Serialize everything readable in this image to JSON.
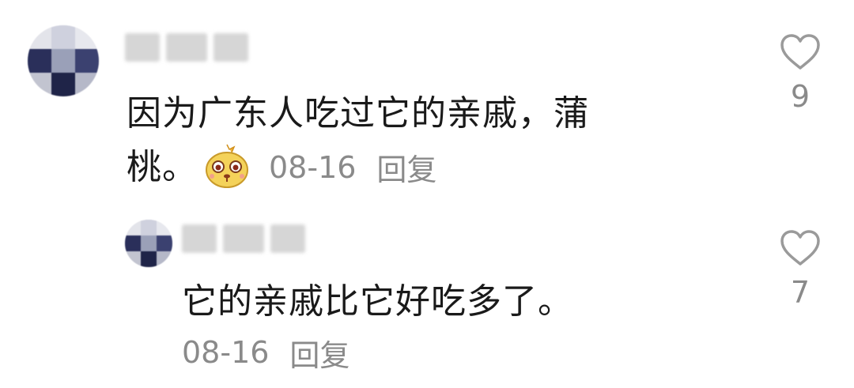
{
  "comments": [
    {
      "text_line1": "因为广东人吃过它的亲戚，蒲",
      "text_line2": "桃。",
      "emoji": "cute-face-emoji",
      "time": "08-16",
      "reply_label": "回复",
      "likes": "9",
      "username_obscured": true
    },
    {
      "text": "它的亲戚比它好吃多了。",
      "time": "08-16",
      "reply_label": "回复",
      "likes": "7",
      "username_obscured": true
    }
  ],
  "icons": {
    "like": "heart-outline-icon"
  },
  "colors": {
    "text": "#1a1a1a",
    "meta": "#8a8a8a",
    "icon": "#9a9a9a",
    "emoji_face": "#f4d25a"
  }
}
